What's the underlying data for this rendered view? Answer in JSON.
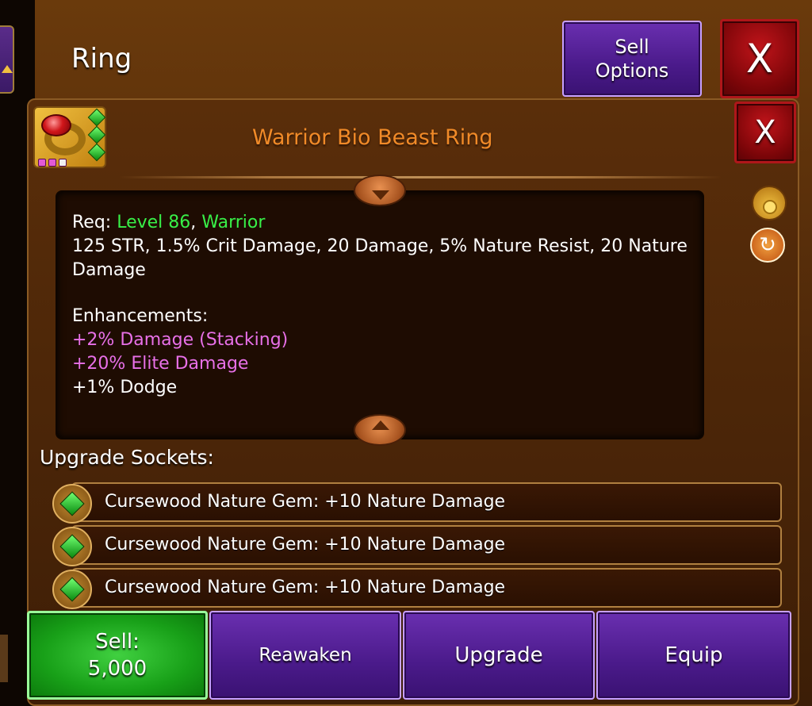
{
  "window": {
    "title": "Ring",
    "close_label": "X"
  },
  "sell_options": {
    "line1": "Sell",
    "line2": "Options"
  },
  "item": {
    "name": "Warrior Bio Beast Ring",
    "close_label": "X",
    "icon": "red-gem-gold-ring-icon",
    "socket_count": 3,
    "enhancement_pips": 3
  },
  "description": {
    "req_label": "Req:",
    "req_level": "Level 86",
    "req_sep": ",",
    "req_class": "Warrior",
    "stats_line": "125 STR, 1.5% Crit Damage, 20 Damage, 5% Nature Resist, 20 Nature Damage",
    "enhancements_label": "Enhancements:",
    "enhancements": [
      {
        "text": "+2% Damage (Stacking)",
        "color": "pink"
      },
      {
        "text": "+20% Elite Damage",
        "color": "pink"
      },
      {
        "text": "+1% Dodge",
        "color": "white"
      }
    ]
  },
  "sockets": {
    "title": "Upgrade Sockets:",
    "items": [
      "Cursewood Nature Gem: +10 Nature Damage",
      "Cursewood Nature Gem: +10 Nature Damage",
      "Cursewood Nature Gem: +10 Nature Damage"
    ]
  },
  "actions": {
    "sell_label": "Sell:",
    "sell_price": "5,000",
    "reawaken": "Reawaken",
    "upgrade": "Upgrade",
    "equip": "Equip"
  },
  "colors": {
    "item_name": "#f08a28",
    "requirement_green": "#38f048",
    "enhancement_pink": "#e870e8",
    "sell_green": "#18a018",
    "button_purple": "#4a1a8a",
    "close_red": "#7a0508"
  }
}
